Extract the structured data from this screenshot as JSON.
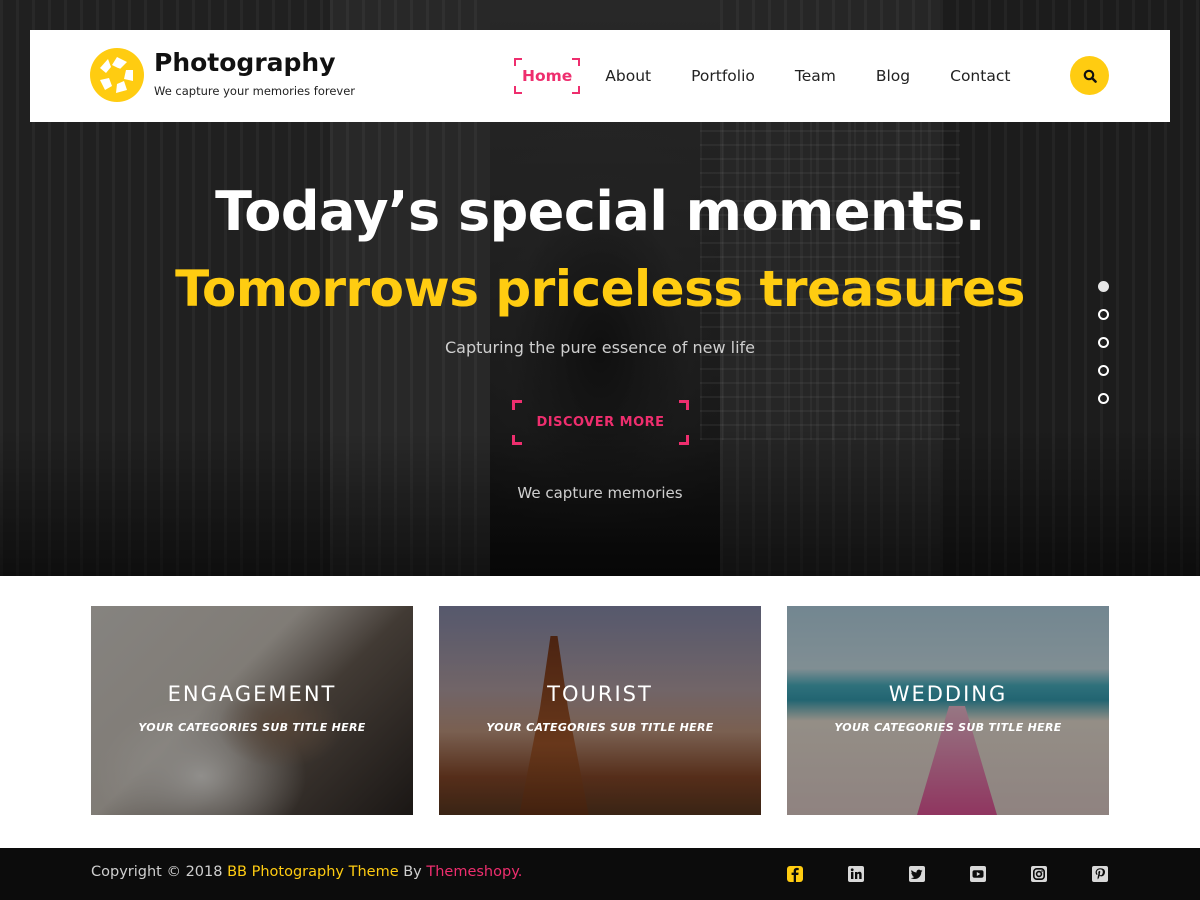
{
  "colors": {
    "accent_yellow": "#ffcc11",
    "accent_pink": "#ee2e6e",
    "footer_bg": "#0c0c0c",
    "header_bg": "#ffffff"
  },
  "header": {
    "brand_title": "Photography",
    "brand_tagline": "We capture your memories forever",
    "logo_icon": "aperture-icon",
    "nav": [
      {
        "label": "Home",
        "active": true
      },
      {
        "label": "About",
        "active": false
      },
      {
        "label": "Portfolio",
        "active": false
      },
      {
        "label": "Team",
        "active": false
      },
      {
        "label": "Blog",
        "active": false
      },
      {
        "label": "Contact",
        "active": false
      }
    ],
    "search_icon": "search-icon"
  },
  "hero": {
    "title": "Today’s special moments.",
    "title_highlight": "Tomorrows priceless treasures",
    "subtitle": "Capturing the pure essence of new life",
    "button_label": "DISCOVER MORE",
    "caption": "We capture memories",
    "slides_total": 5,
    "active_slide": 1
  },
  "categories": [
    {
      "title": "ENGAGEMENT",
      "subtitle": "YOUR CATEGORIES SUB TITLE HERE"
    },
    {
      "title": "TOURIST",
      "subtitle": "YOUR CATEGORIES SUB TITLE HERE"
    },
    {
      "title": "WEDDING",
      "subtitle": "YOUR CATEGORIES SUB TITLE HERE"
    }
  ],
  "footer": {
    "copyright_prefix": "Copyright © 2018 ",
    "theme_link": "BB Photography Theme",
    "by_text": " By ",
    "author_link": "Themeshopy.",
    "social": [
      "facebook-icon",
      "linkedin-icon",
      "twitter-icon",
      "youtube-icon",
      "instagram-icon",
      "pinterest-icon"
    ]
  }
}
